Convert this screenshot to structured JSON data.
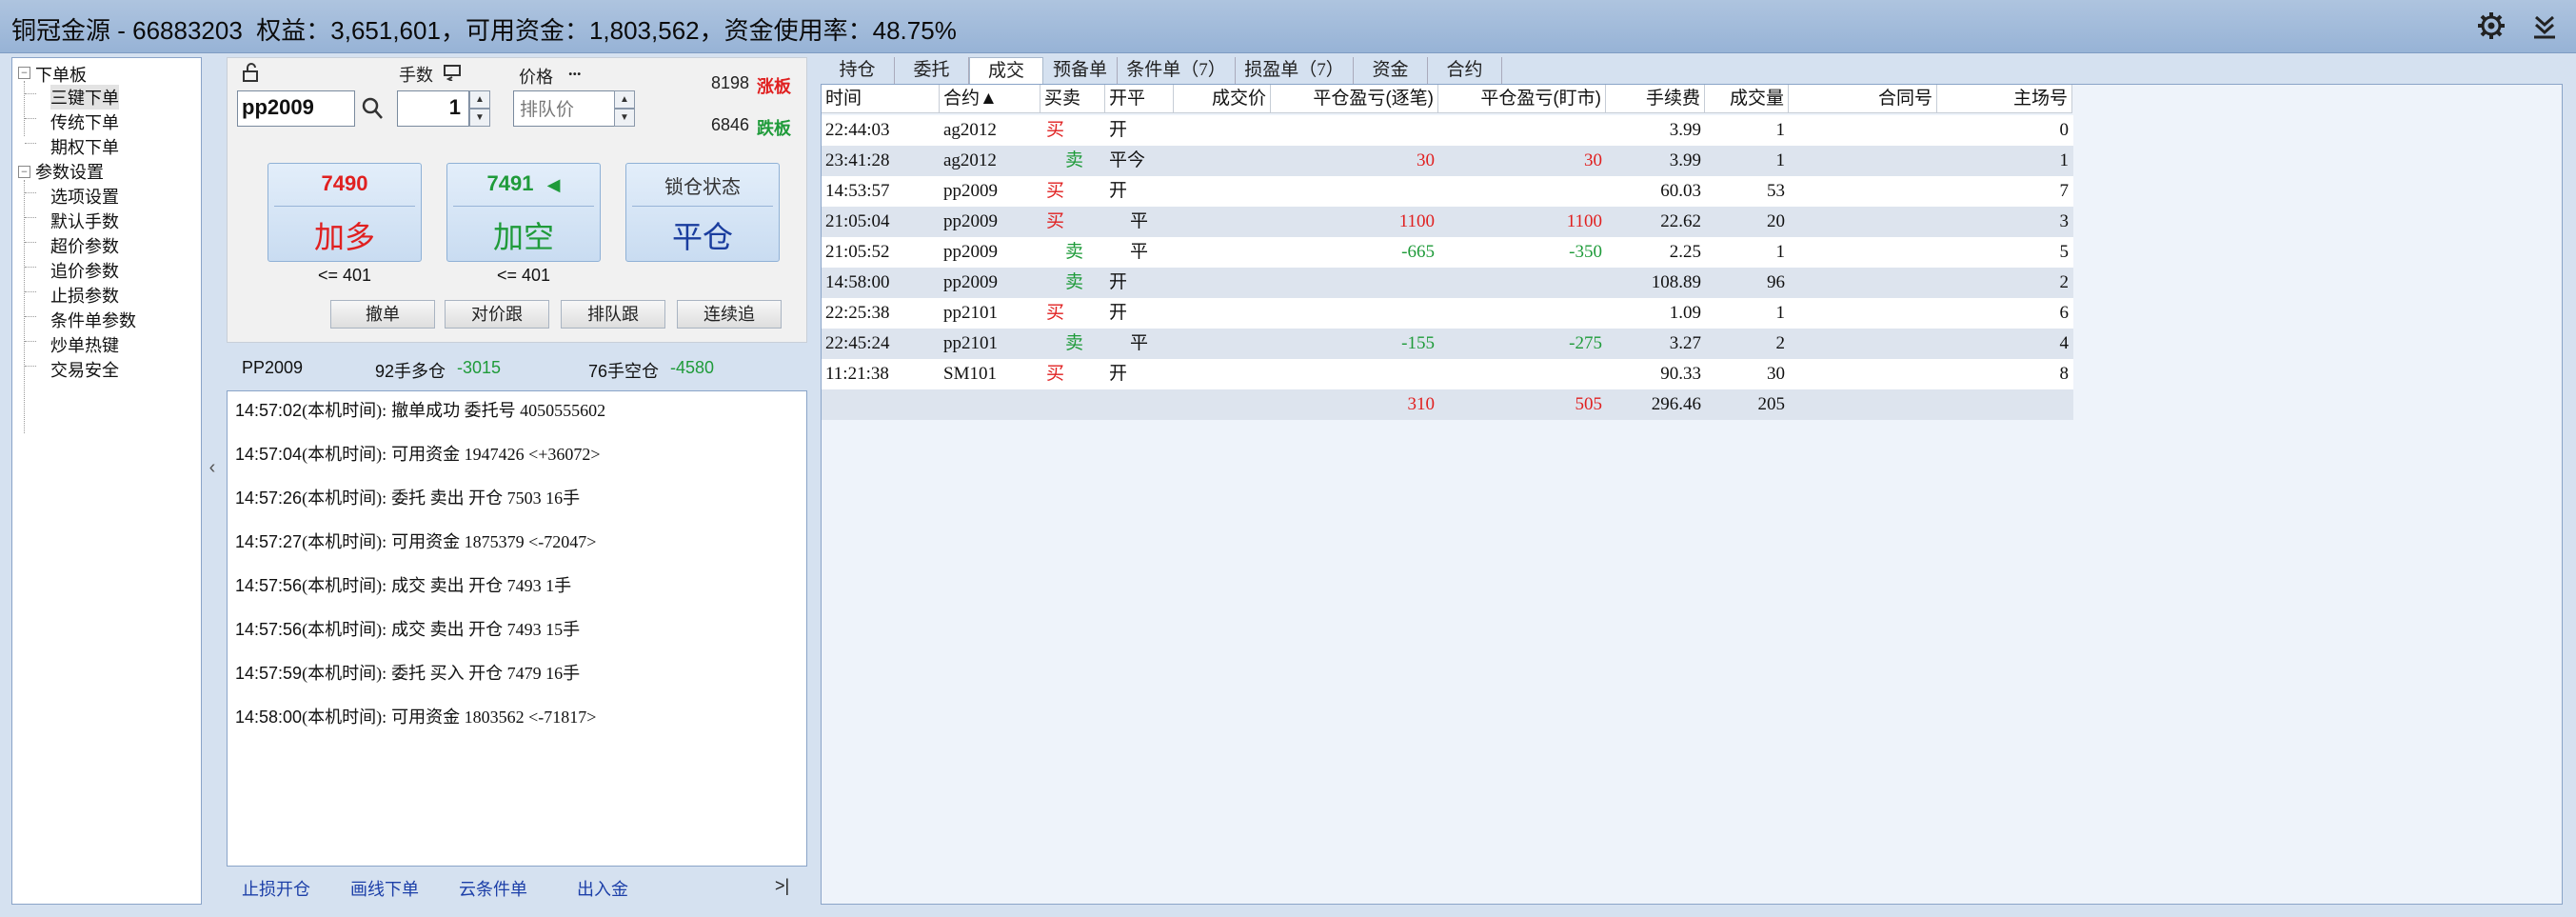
{
  "title": {
    "app": "铜冠金源 - 66883203",
    "equity_label": "权益：",
    "equity": "3,651,601",
    "avail_label": "，可用资金：",
    "avail": "1,803,562",
    "usage_label": "，资金使用率：",
    "usage": "48.75%"
  },
  "icons": {
    "settings": "gear-icon",
    "download": "download-icon"
  },
  "tree": {
    "group1": "下单板",
    "items1": [
      "三键下单",
      "传统下单",
      "期权下单"
    ],
    "group2": "参数设置",
    "items2": [
      "选项设置",
      "默认手数",
      "超价参数",
      "追价参数",
      "止损参数",
      "条件单参数",
      "炒单热键",
      "交易安全"
    ]
  },
  "order": {
    "lots_label": "手数",
    "price_label": "价格",
    "price_dots": "...",
    "contract": "pp2009",
    "lots": "1",
    "price_mode": "排队价",
    "limit_up_price": "8198",
    "limit_up_label": "涨板",
    "limit_down_price": "6846",
    "limit_down_label": "跌板",
    "buy_price": "7490",
    "buy_label": "加多",
    "sell_price": "7491",
    "sell_label": "加空",
    "lock_label": "锁仓状态",
    "close_label": "平仓",
    "buy_under": "<= 401",
    "sell_under": "<= 401",
    "btn_cancel": "撤单",
    "btn_opp": "对价跟",
    "btn_queue": "排队跟",
    "btn_chase": "连续追"
  },
  "position": {
    "contract": "PP2009",
    "long": "92手多仓",
    "long_pnl": "-3015",
    "short": "76手空仓",
    "short_pnl": "-4580"
  },
  "log": [
    {
      "time": "14:57:02",
      "tag": "(本机时间):",
      "msg": "撤单成功  委托号  4050555602"
    },
    {
      "time": "14:57:04",
      "tag": "(本机时间):",
      "msg": "可用资金  1947426  <+36072>"
    },
    {
      "time": "14:57:26",
      "tag": "(本机时间):",
      "msg": "委托  卖出  开仓  7503  16手"
    },
    {
      "time": "14:57:27",
      "tag": "(本机时间):",
      "msg": "可用资金  1875379  <-72047>"
    },
    {
      "time": "14:57:56",
      "tag": "(本机时间):",
      "msg": "成交  卖出  开仓  7493  1手"
    },
    {
      "time": "14:57:56",
      "tag": "(本机时间):",
      "msg": "成交  卖出  开仓  7493  15手"
    },
    {
      "time": "14:57:59",
      "tag": "(本机时间):",
      "msg": "委托  买入  开仓  7479  16手"
    },
    {
      "time": "14:58:00",
      "tag": "(本机时间):",
      "msg": "可用资金  1803562  <-71817>"
    }
  ],
  "bottom_links": [
    "止损开仓",
    "画线下单",
    "云条件单",
    "出入金"
  ],
  "bottom_expand": ">|",
  "collapse": "‹",
  "tabs": [
    "持仓",
    "委托",
    "成交",
    "预备单",
    "条件单（7）",
    "损盈单（7）",
    "资金",
    "合约"
  ],
  "columns": [
    "时间",
    "合约▲",
    "买卖",
    "开平",
    "成交价",
    "平仓盈亏(逐笔)",
    "平仓盈亏(盯市)",
    "手续费",
    "成交量",
    "合同号",
    "主场号"
  ],
  "rows": [
    {
      "time": "22:44:03",
      "contract": "ag2012",
      "side": "买",
      "oc": "开",
      "price": "",
      "pnl1": "",
      "pnl2": "",
      "fee": "3.99",
      "vol": "1",
      "order": "",
      "seq": "0"
    },
    {
      "time": "23:41:28",
      "contract": "ag2012",
      "side": "卖",
      "oc": "平今",
      "price": "",
      "pnl1": "30",
      "pnl2": "30",
      "fee": "3.99",
      "vol": "1",
      "order": "",
      "seq": "1"
    },
    {
      "time": "14:53:57",
      "contract": "pp2009",
      "side": "买",
      "oc": "开",
      "price": "",
      "pnl1": "",
      "pnl2": "",
      "fee": "60.03",
      "vol": "53",
      "order": "",
      "seq": "7"
    },
    {
      "time": "21:05:04",
      "contract": "pp2009",
      "side": "买",
      "oc": "平",
      "price": "",
      "pnl1": "1100",
      "pnl2": "1100",
      "fee": "22.62",
      "vol": "20",
      "order": "",
      "seq": "3"
    },
    {
      "time": "21:05:52",
      "contract": "pp2009",
      "side": "卖",
      "oc": "平",
      "price": "",
      "pnl1": "-665",
      "pnl2": "-350",
      "fee": "2.25",
      "vol": "1",
      "order": "",
      "seq": "5"
    },
    {
      "time": "14:58:00",
      "contract": "pp2009",
      "side": "卖",
      "oc": "开",
      "price": "",
      "pnl1": "",
      "pnl2": "",
      "fee": "108.89",
      "vol": "96",
      "order": "",
      "seq": "2"
    },
    {
      "time": "22:25:38",
      "contract": "pp2101",
      "side": "买",
      "oc": "开",
      "price": "",
      "pnl1": "",
      "pnl2": "",
      "fee": "1.09",
      "vol": "1",
      "order": "",
      "seq": "6"
    },
    {
      "time": "22:45:24",
      "contract": "pp2101",
      "side": "卖",
      "oc": "平",
      "price": "",
      "pnl1": "-155",
      "pnl2": "-275",
      "fee": "3.27",
      "vol": "2",
      "order": "",
      "seq": "4"
    },
    {
      "time": "11:21:38",
      "contract": "SM101",
      "side": "买",
      "oc": "开",
      "price": "",
      "pnl1": "",
      "pnl2": "",
      "fee": "90.33",
      "vol": "30",
      "order": "",
      "seq": "8"
    }
  ],
  "totals": {
    "pnl1": "310",
    "pnl2": "505",
    "fee": "296.46",
    "vol": "205"
  },
  "colors": {
    "buy": "#e02020",
    "sell": "#1f9b3a",
    "accent": "#97b3d6"
  }
}
